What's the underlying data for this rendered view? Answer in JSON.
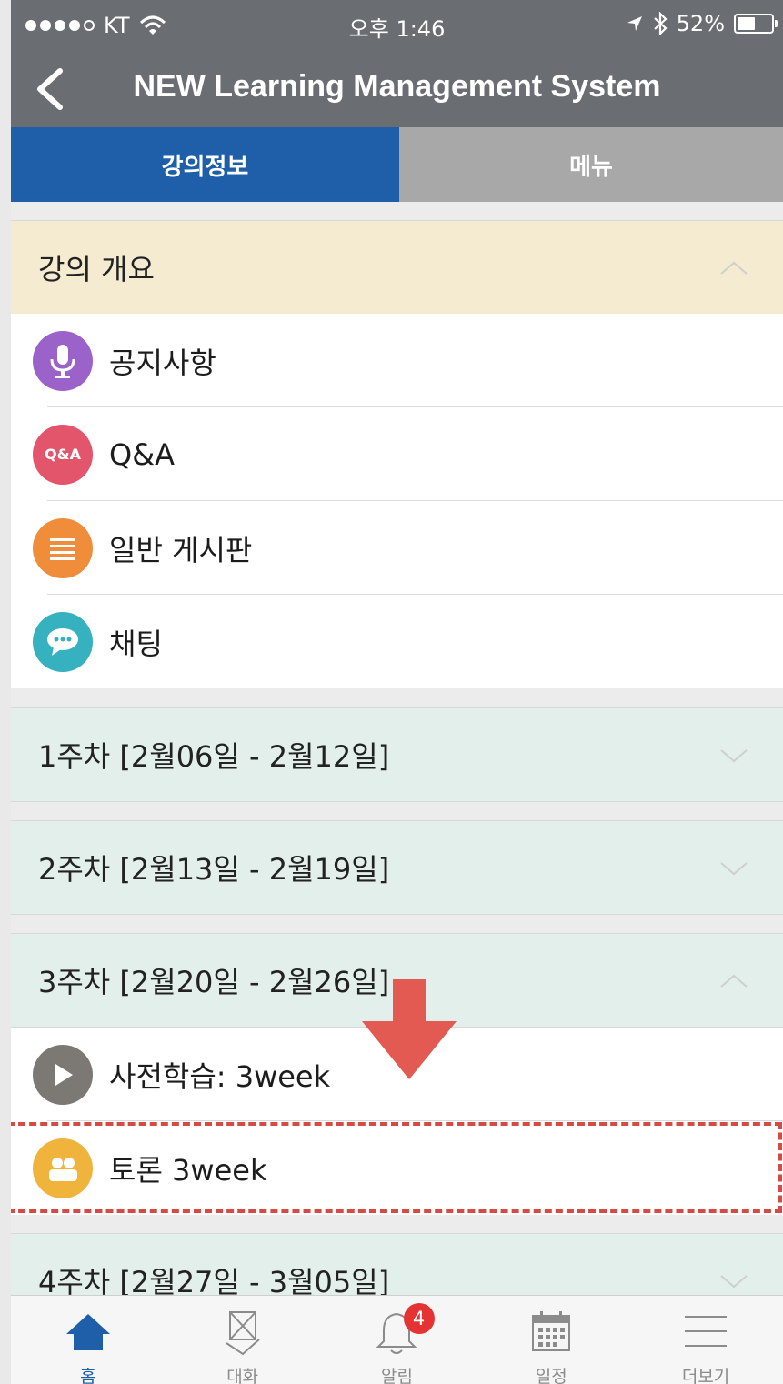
{
  "status_bar": {
    "carrier": "KT",
    "time": "오후 1:46",
    "battery": "52%",
    "battery_level": 0.52
  },
  "nav": {
    "title": "NEW Learning Management System",
    "back_icon": "chevron-left-icon"
  },
  "tabs": [
    {
      "label": "강의정보",
      "active": true
    },
    {
      "label": "메뉴",
      "active": false
    }
  ],
  "overview": {
    "title": "강의 개요",
    "expanded": true,
    "items": [
      {
        "label": "공지사항",
        "icon": "microphone-icon",
        "color": "#9b63c9"
      },
      {
        "label": "Q&A",
        "icon": "qa-icon",
        "icon_text": "Q&A",
        "color": "#e2556a"
      },
      {
        "label": "일반 게시판",
        "icon": "list-icon",
        "color": "#f08d3a"
      },
      {
        "label": "채팅",
        "icon": "chat-bubble-icon",
        "color": "#36b1bf"
      }
    ]
  },
  "weeks": [
    {
      "title": "1주차 [2월06일 - 2월12일]",
      "expanded": false
    },
    {
      "title": "2주차 [2월13일 - 2월19일]",
      "expanded": false
    },
    {
      "title": "3주차 [2월20일 - 2월26일]",
      "expanded": true,
      "items": [
        {
          "label": "사전학습: 3week",
          "icon": "play-icon",
          "color": "#7c7874"
        },
        {
          "label": "토론 3week",
          "icon": "people-icon",
          "color": "#f0b43c",
          "highlighted": true
        }
      ]
    },
    {
      "title": "4주차 [2월27일 - 3월05일]",
      "expanded": false
    }
  ],
  "annotation": {
    "highlight_color": "#d64a44",
    "arrow_color": "#e35a52"
  },
  "bottom_tabs": [
    {
      "label": "홈",
      "icon": "home-icon",
      "active": true
    },
    {
      "label": "대화",
      "icon": "conversation-icon",
      "active": false
    },
    {
      "label": "알림",
      "icon": "bell-icon",
      "active": false,
      "badge": "4"
    },
    {
      "label": "일정",
      "icon": "calendar-icon",
      "active": false
    },
    {
      "label": "더보기",
      "icon": "menu-icon",
      "active": false
    }
  ],
  "colors": {
    "accent": "#1f5ea8",
    "header_bg": "#6a6d72",
    "overview_bg": "#f4ebd0",
    "week_bg": "#e3efeb"
  }
}
